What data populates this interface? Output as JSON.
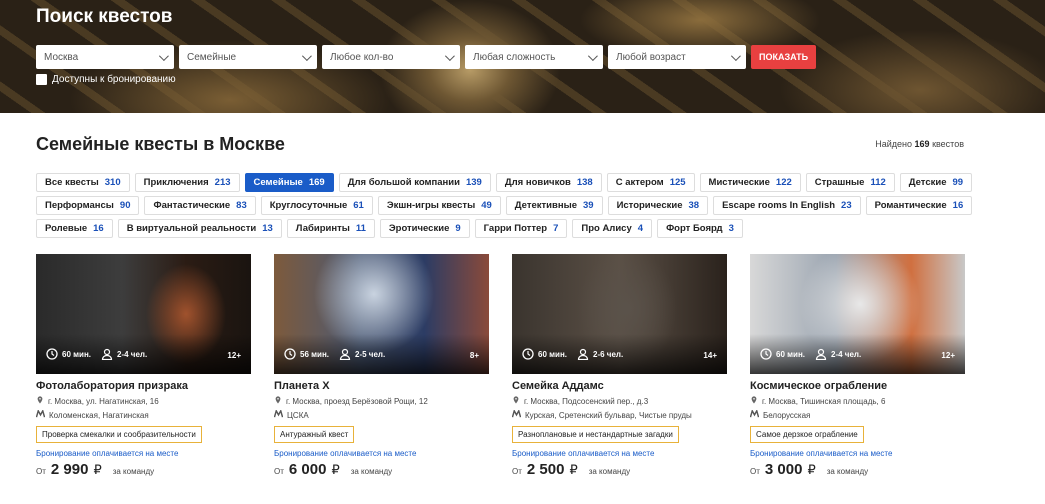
{
  "hero": {
    "title": "Поиск квестов",
    "filters": [
      "Москва",
      "Семейные",
      "Любое кол-во",
      "Любая сложность",
      "Любой возраст"
    ],
    "show_button": "ПОКАЗАТЬ",
    "availability_label": "Доступны к бронированию"
  },
  "heading": "Семейные квесты в Москве",
  "found": {
    "prefix": "Найдено",
    "count": "169",
    "suffix": "квестов"
  },
  "tags": [
    [
      [
        "Все квесты",
        "310"
      ],
      [
        "Приключения",
        "213"
      ],
      [
        "Семейные",
        "169"
      ],
      [
        "Для большой компании",
        "139"
      ],
      [
        "Для новичков",
        "138"
      ],
      [
        "С актером",
        "125"
      ],
      [
        "Мистические",
        "122"
      ],
      [
        "Страшные",
        "112"
      ],
      [
        "Детские",
        "99"
      ]
    ],
    [
      [
        "Перформансы",
        "90"
      ],
      [
        "Фантастические",
        "83"
      ],
      [
        "Круглосуточные",
        "61"
      ],
      [
        "Экшн-игры квесты",
        "49"
      ],
      [
        "Детективные",
        "39"
      ],
      [
        "Исторические",
        "38"
      ],
      [
        "Escape rooms In English",
        "23"
      ],
      [
        "Романтические",
        "16"
      ]
    ],
    [
      [
        "Ролевые",
        "16"
      ],
      [
        "В виртуальной реальности",
        "13"
      ],
      [
        "Лабиринты",
        "11"
      ],
      [
        "Эротические",
        "9"
      ],
      [
        "Гарри Поттер",
        "7"
      ],
      [
        "Про Алису",
        "4"
      ],
      [
        "Форт Боярд",
        "3"
      ]
    ]
  ],
  "active_tag": "Семейные",
  "cards": [
    {
      "duration": "60 мин.",
      "players": "2-4 чел.",
      "age": "12+",
      "name": "Фотолаборатория призрака",
      "address": "г. Москва, ул. Нагатинская, 16",
      "metro": "Коломенская, Нагатинская",
      "badge": "Проверка смекалки и сообразительности",
      "booking": "Бронирование оплачивается на месте",
      "price_from": "От",
      "price": "2 990",
      "currency": "₽",
      "per": "за команду"
    },
    {
      "duration": "56 мин.",
      "players": "2-5 чел.",
      "age": "8+",
      "name": "Планета Х",
      "address": "г. Москва, проезд Берёзовой Рощи, 12",
      "metro": "ЦСКА",
      "badge": "Антуражный квест",
      "booking": "Бронирование оплачивается на месте",
      "price_from": "От",
      "price": "6 000",
      "currency": "₽",
      "per": "за команду"
    },
    {
      "duration": "60 мин.",
      "players": "2-6 чел.",
      "age": "14+",
      "name": "Семейка Аддамс",
      "address": "г. Москва, Подсосенский пер., д.3",
      "metro": "Курская, Сретенский бульвар, Чистые пруды",
      "badge": "Разноплановые и нестандартные загадки",
      "booking": "Бронирование оплачивается на месте",
      "price_from": "От",
      "price": "2 500",
      "currency": "₽",
      "per": "за команду"
    },
    {
      "duration": "60 мин.",
      "players": "2-4 чел.",
      "age": "12+",
      "name": "Космическое ограбление",
      "address": "г. Москва, Тишинская площадь, 6",
      "metro": "Белорусская",
      "badge": "Самое дерзкое ограбление",
      "booking": "Бронирование оплачивается на месте",
      "price_from": "От",
      "price": "3 000",
      "currency": "₽",
      "per": "за команду"
    }
  ]
}
